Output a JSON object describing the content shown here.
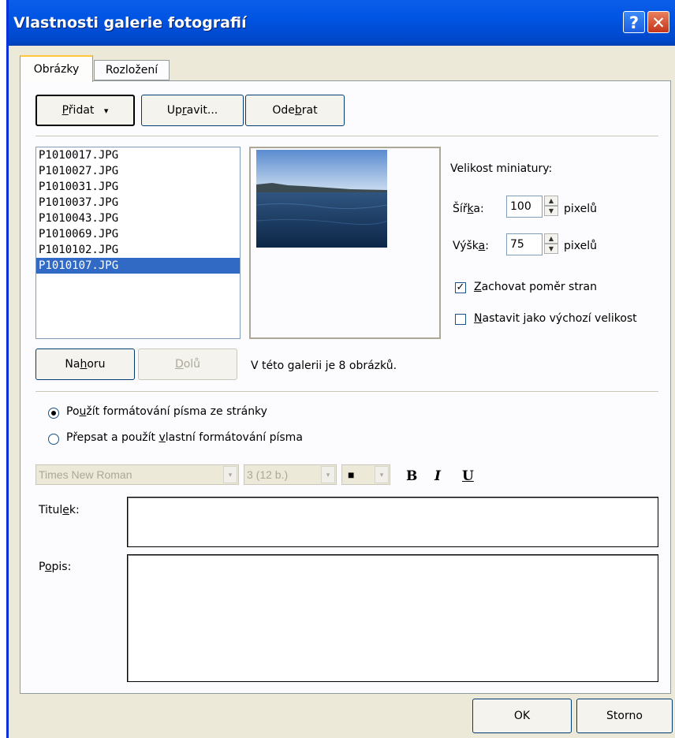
{
  "window": {
    "title": "Vlastnosti galerie fotografií",
    "help_glyph": "?",
    "close_glyph": "✕"
  },
  "tabs": [
    {
      "label": "Obrázky"
    },
    {
      "label": "Rozložení"
    }
  ],
  "toolbar": {
    "add": {
      "pre": "",
      "acc": "P",
      "post": "řidat",
      "arrow": "▾"
    },
    "edit": {
      "pre": "Up",
      "acc": "r",
      "post": "avit..."
    },
    "remove": {
      "pre": "Ode",
      "acc": "b",
      "post": "rat"
    }
  },
  "files": [
    "P1010017.JPG",
    "P1010027.JPG",
    "P1010031.JPG",
    "P1010037.JPG",
    "P1010043.JPG",
    "P1010069.JPG",
    "P1010102.JPG",
    "P1010107.JPG"
  ],
  "selected_file": "P1010107.JPG",
  "thumbnail": {
    "heading": "Velikost miniatury:",
    "width": {
      "pre": "Šíř",
      "acc": "k",
      "post": "a:",
      "value": "100",
      "unit": "pixelů"
    },
    "height": {
      "pre": "Výšk",
      "acc": "a",
      "post": ":",
      "value": "75",
      "unit": "pixelů"
    },
    "keep_ratio": {
      "pre": "",
      "acc": "Z",
      "post": "achovat poměr stran",
      "checked": true
    },
    "set_default": {
      "pre": "",
      "acc": "N",
      "post": "astavit jako výchozí velikost",
      "checked": false
    }
  },
  "move": {
    "up": {
      "pre": "Na",
      "acc": "h",
      "post": "oru"
    },
    "down": {
      "pre": "",
      "acc": "D",
      "post": "olů"
    }
  },
  "count_text": "V této galerii je 8 obrázků.",
  "font_options": {
    "use_page": {
      "pre": "Po",
      "acc": "u",
      "post": "žít formátování písma ze stránky",
      "selected": true
    },
    "custom": {
      "pre": "Přepsat a použít ",
      "acc": "v",
      "post": "lastní formátování písma",
      "selected": false
    }
  },
  "font": {
    "family": "Times New Roman",
    "size": "3 (12 b.)",
    "bold": "B",
    "italic": "I",
    "underline": "U",
    "color_glyph": "■",
    "dropdown_glyph": "▾"
  },
  "caption": {
    "pre": "Titul",
    "acc": "e",
    "post": "k:",
    "value": ""
  },
  "description": {
    "pre": "P",
    "acc": "o",
    "post": "pis:",
    "value": ""
  },
  "buttons": {
    "ok": "OK",
    "cancel": "Storno"
  }
}
